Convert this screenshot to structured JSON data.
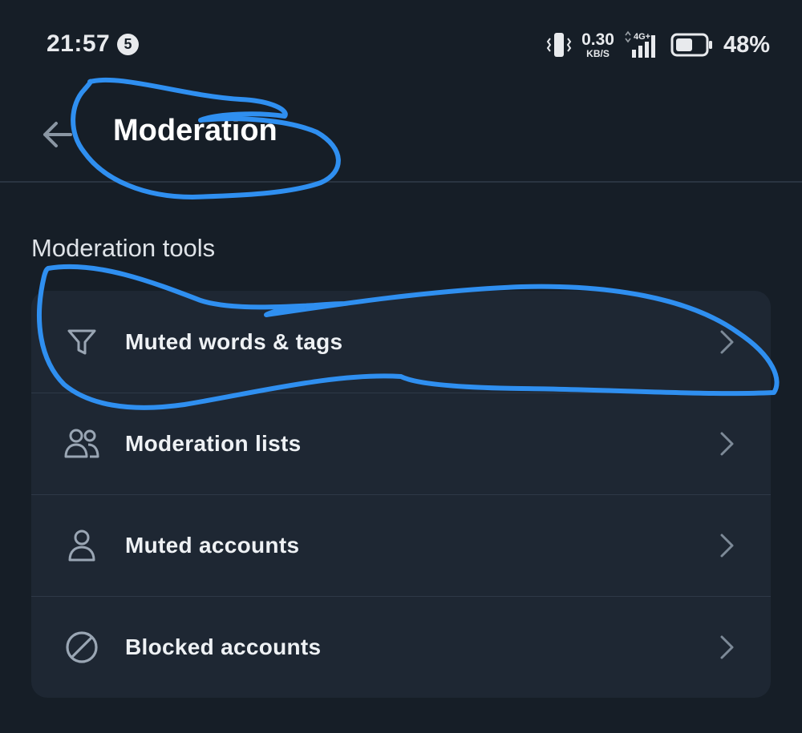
{
  "status_bar": {
    "time": "21:57",
    "notification_count": "5",
    "net_speed_value": "0.30",
    "net_speed_unit": "KB/S",
    "network_type": "4G+",
    "battery": "48%"
  },
  "header": {
    "title": "Moderation"
  },
  "section": {
    "title": "Moderation tools"
  },
  "menu": {
    "items": [
      {
        "label": "Muted words & tags",
        "icon": "filter-icon"
      },
      {
        "label": "Moderation lists",
        "icon": "people-icon"
      },
      {
        "label": "Muted accounts",
        "icon": "person-icon"
      },
      {
        "label": "Blocked accounts",
        "icon": "block-icon"
      }
    ]
  },
  "colors": {
    "background": "#161e27",
    "card": "#1e2733",
    "annotation": "#2f8ff0",
    "icon": "#9aa6b4"
  }
}
